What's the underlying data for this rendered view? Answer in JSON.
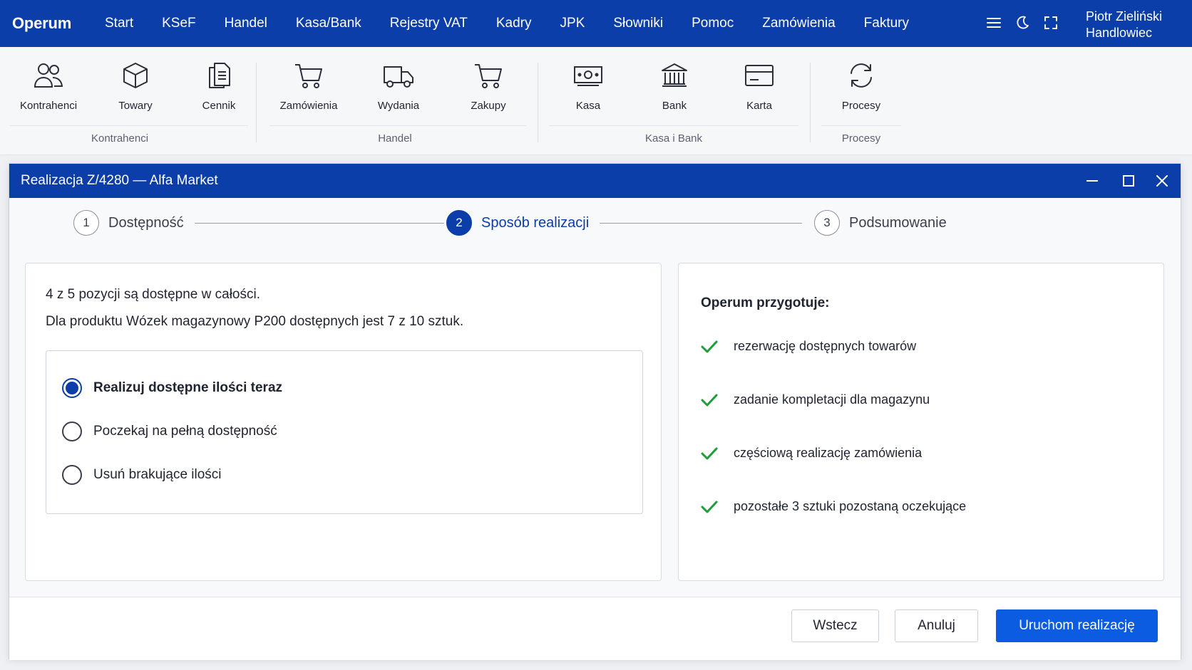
{
  "app": {
    "brand": "Operum",
    "nav": [
      "Start",
      "KSeF",
      "Handel",
      "Kasa/Bank",
      "Rejestry VAT",
      "Kadry",
      "JPK",
      "Słowniki",
      "Pomoc",
      "Zamówienia",
      "Faktury"
    ],
    "user": {
      "name": "Piotr Zieliński",
      "role": "Handlowiec"
    },
    "top_icons": [
      "menu-icon",
      "moon-icon",
      "fullscreen-icon"
    ]
  },
  "ribbon": {
    "groups": [
      {
        "label": "Kontrahenci",
        "items": [
          {
            "label": "Kontrahenci",
            "icon": "users-icon"
          },
          {
            "label": "Towary",
            "icon": "box-icon"
          },
          {
            "label": "Cennik",
            "icon": "documents-icon"
          }
        ]
      },
      {
        "label": "Handel",
        "items": [
          {
            "label": "Zamówienia",
            "icon": "cart-icon"
          },
          {
            "label": "Wydania",
            "icon": "truck-icon"
          },
          {
            "label": "Zakupy",
            "icon": "cart-icon"
          }
        ]
      },
      {
        "label": "Kasa i Bank",
        "items": [
          {
            "label": "Kasa",
            "icon": "cash-icon"
          },
          {
            "label": "Bank",
            "icon": "bank-icon"
          },
          {
            "label": "Karta",
            "icon": "card-icon"
          }
        ]
      },
      {
        "label": "Procesy",
        "items": [
          {
            "label": "Procesy",
            "icon": "refresh-icon"
          }
        ]
      }
    ]
  },
  "dialog": {
    "title": "Realizacja Z/4280 — Alfa Market",
    "steps": [
      {
        "number": "1",
        "label": "Dostępność",
        "active": false
      },
      {
        "number": "2",
        "label": "Sposób realizacji",
        "active": true
      },
      {
        "number": "3",
        "label": "Podsumowanie",
        "active": false
      }
    ],
    "info_line1": "4 z 5 pozycji są dostępne w całości.",
    "info_line2": "Dla produktu Wózek magazynowy P200 dostępnych jest 7 z 10 sztuk.",
    "options": [
      {
        "label": "Realizuj dostępne ilości teraz",
        "checked": true
      },
      {
        "label": "Poczekaj na pełną dostępność",
        "checked": false
      },
      {
        "label": "Usuń brakujące ilości",
        "checked": false
      }
    ],
    "summary_title": "Operum przygotuje:",
    "summary_items": [
      "rezerwację dostępnych towarów",
      "zadanie kompletacji dla magazynu",
      "częściową realizację zamówienia",
      "pozostałe 3 sztuki pozostaną oczekujące"
    ],
    "buttons": {
      "back": "Wstecz",
      "cancel": "Anuluj",
      "run": "Uruchom realizację"
    },
    "colors": {
      "accent": "#0b3ea8",
      "primary_button": "#0b5ce0",
      "check": "#1f9d3a"
    }
  }
}
